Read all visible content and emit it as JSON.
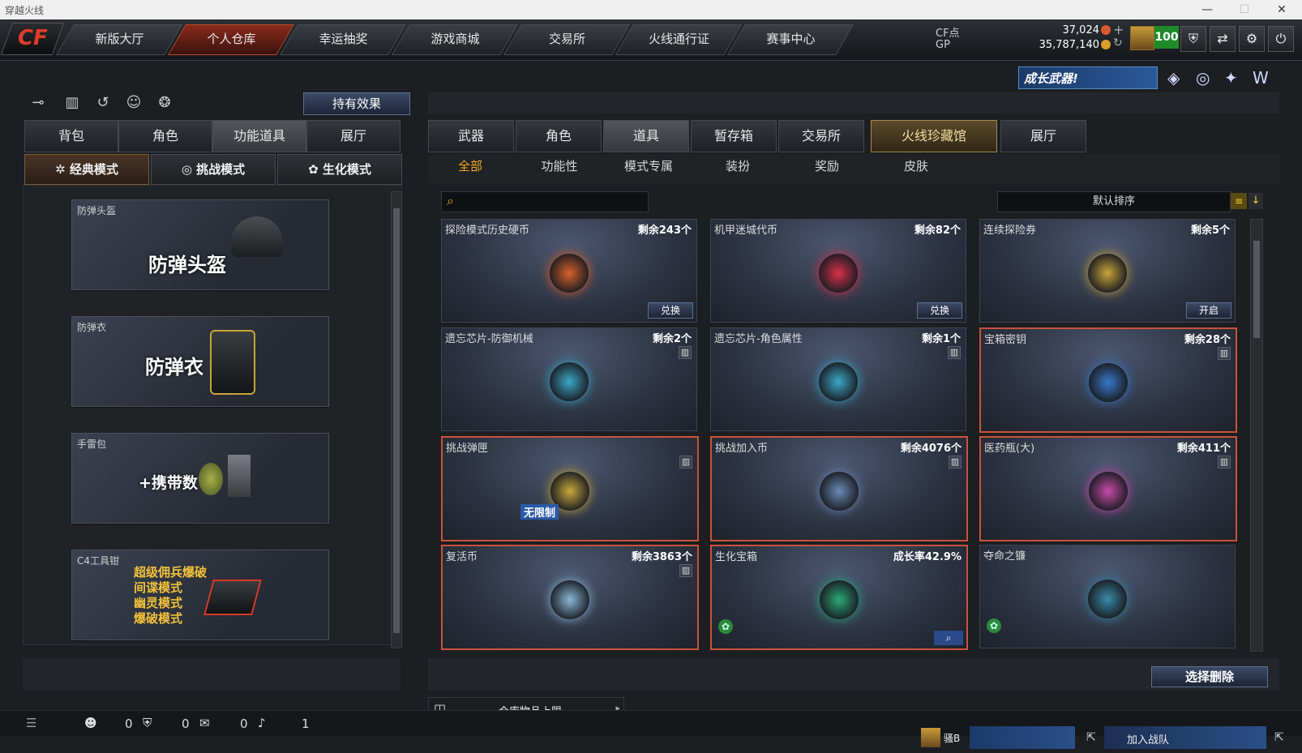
{
  "window": {
    "title": "穿越火线"
  },
  "nav": {
    "logo": "CF",
    "tabs": [
      "新版大厅",
      "个人仓库",
      "幸运抽奖",
      "游戏商城",
      "交易所",
      "火线通行证",
      "赛事中心"
    ],
    "active_tab": "个人仓库"
  },
  "currency": {
    "cf_label": "CF点",
    "cf_value": "37,024",
    "gp_label": "GP",
    "gp_value": "35,787,140",
    "level_badge": "100"
  },
  "banner": {
    "text": "成长武器!"
  },
  "left": {
    "effect_button": "持有效果",
    "tabs": [
      "背包",
      "角色",
      "功能道具",
      "展厅"
    ],
    "active_tab": "功能道具",
    "modes": [
      "经典模式",
      "挑战模式",
      "生化模式"
    ],
    "active_mode": "经典模式",
    "items": [
      {
        "label": "防弹头盔",
        "big": "防弹头盔"
      },
      {
        "label": "防弹衣",
        "big": "防弹衣"
      },
      {
        "label": "手雷包",
        "big": "+携带数"
      },
      {
        "label": "C4工具钳",
        "lines": [
          "超级佣兵爆破",
          "间谍模式",
          "幽灵模式",
          "爆破模式"
        ]
      }
    ]
  },
  "right": {
    "tabs": [
      "武器",
      "角色",
      "道具",
      "暂存箱",
      "交易所",
      "火线珍藏馆",
      "展厅"
    ],
    "active_tab": "道具",
    "subtabs": [
      "全部",
      "功能性",
      "模式专属",
      "装扮",
      "奖励",
      "皮肤"
    ],
    "active_subtab": "全部",
    "search": {
      "placeholder": ""
    },
    "sort_label": "默认排序",
    "cards": [
      {
        "name": "探险模式历史硬币",
        "count": "剩余243个",
        "action": "兑换",
        "red": false
      },
      {
        "name": "机甲迷城代币",
        "count": "剩余82个",
        "action": "兑换",
        "red": false
      },
      {
        "name": "连续探险券",
        "count": "剩余5个",
        "action": "开启",
        "red": false
      },
      {
        "name": "遗忘芯片-防御机械",
        "count": "剩余2个",
        "action": "",
        "red": false
      },
      {
        "name": "遗忘芯片-角色属性",
        "count": "剩余1个",
        "action": "",
        "red": false
      },
      {
        "name": "宝箱密钥",
        "count": "剩余28个",
        "action": "",
        "red": true
      },
      {
        "name": "挑战弹匣",
        "count": "",
        "action": "",
        "red": true,
        "badge": "无限制"
      },
      {
        "name": "挑战加入币",
        "count": "剩余4076个",
        "action": "",
        "red": true
      },
      {
        "name": "医药瓶(大)",
        "count": "剩余411个",
        "action": "",
        "red": true
      },
      {
        "name": "复活币",
        "count": "剩余3863个",
        "action": "",
        "red": true
      },
      {
        "name": "生化宝箱",
        "count": "成长率42.9%",
        "action": "",
        "red": true
      },
      {
        "name": "夺命之镰",
        "count": "",
        "action": "",
        "red": false
      }
    ],
    "delete_button": "选择删除",
    "capacity_label": "仓库物品上限"
  },
  "status": {
    "counts": [
      "0",
      "0",
      "0",
      "1"
    ],
    "user": "骚B",
    "team_label": "加入战队"
  }
}
